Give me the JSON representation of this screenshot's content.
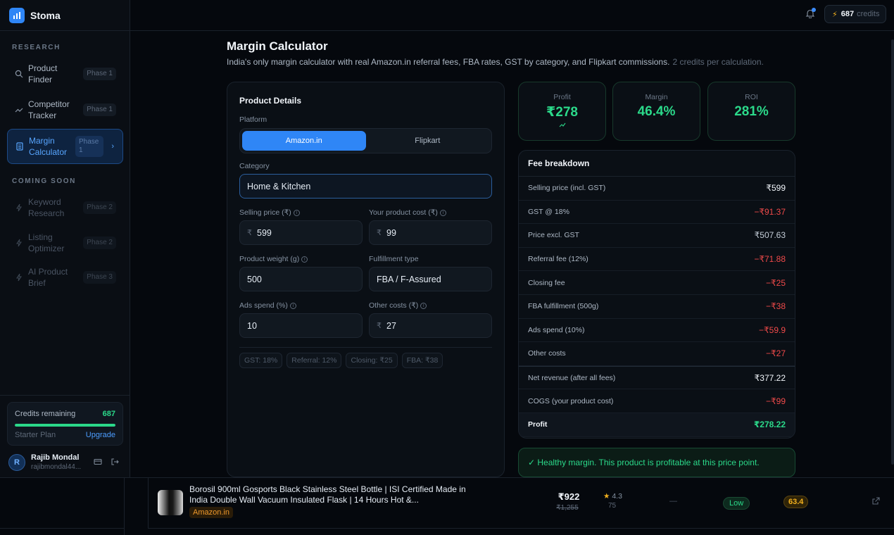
{
  "brand": {
    "name": "Stoma"
  },
  "sidebar": {
    "section_research": "RESEARCH",
    "section_soon": "COMING SOON",
    "research_items": [
      {
        "label": "Product Finder",
        "phase": "Phase 1",
        "icon": "search-icon"
      },
      {
        "label": "Competitor Tracker",
        "phase": "Phase 1",
        "icon": "trend-icon"
      },
      {
        "label": "Margin Calculator",
        "phase": "Phase 1",
        "icon": "calculator-icon"
      }
    ],
    "soon_items": [
      {
        "label": "Keyword Research",
        "phase": "Phase 2",
        "icon": "spark-icon"
      },
      {
        "label": "Listing Optimizer",
        "phase": "Phase 2",
        "icon": "spark-icon"
      },
      {
        "label": "AI Product Brief",
        "phase": "Phase 3",
        "icon": "spark-icon"
      }
    ],
    "credits": {
      "label": "Credits remaining",
      "value": "687",
      "plan": "Starter Plan",
      "upgrade": "Upgrade",
      "fill_fraction": 1.0
    },
    "user": {
      "initial": "R",
      "name": "Rajib Mondal",
      "email": "rajibmondal44..."
    }
  },
  "topbar": {
    "credits_value": "687",
    "credits_label": "credits"
  },
  "page": {
    "title": "Margin Calculator",
    "subtitle": "India's only margin calculator with real Amazon.in referral fees, FBA rates, GST by category, and Flipkart commissions.",
    "subtitle_note": "2 credits per calculation."
  },
  "details": {
    "heading": "Product Details",
    "platform_label": "Platform",
    "platforms": [
      "Amazon.in",
      "Flipkart"
    ],
    "category_label": "Category",
    "category_value": "Home & Kitchen",
    "selling_price_label": "Selling price (₹)",
    "selling_price_value": "599",
    "product_cost_label": "Your product cost (₹)",
    "product_cost_value": "99",
    "weight_label": "Product weight (g)",
    "weight_value": "500",
    "fulfillment_label": "Fulfillment type",
    "fulfillment_value": "FBA / F-Assured",
    "ads_label": "Ads spend (%)",
    "ads_value": "10",
    "other_label": "Other costs (₹)",
    "other_value": "27",
    "currency_symbol": "₹",
    "chips": [
      "GST: 18%",
      "Referral: 12%",
      "Closing: ₹25",
      "FBA: ₹38"
    ]
  },
  "stats": {
    "profit_label": "Profit",
    "profit_value": "₹278",
    "margin_label": "Margin",
    "margin_value": "46.4%",
    "roi_label": "ROI",
    "roi_value": "281%"
  },
  "breakdown": {
    "heading": "Fee breakdown",
    "rows": [
      {
        "label": "Selling price (incl. GST)",
        "value": "₹599"
      },
      {
        "label": "GST @ 18%",
        "value": "−₹91.37"
      },
      {
        "label": "Price excl. GST",
        "value": "₹507.63"
      },
      {
        "label": "Referral fee (12%)",
        "value": "−₹71.88"
      },
      {
        "label": "Closing fee",
        "value": "−₹25"
      },
      {
        "label": "FBA fulfillment (500g)",
        "value": "−₹38"
      },
      {
        "label": "Ads spend (10%)",
        "value": "−₹59.9"
      },
      {
        "label": "Other costs",
        "value": "−₹27"
      },
      {
        "label": "Net revenue (after all fees)",
        "value": "₹377.22"
      },
      {
        "label": "COGS (your product cost)",
        "value": "−₹99"
      },
      {
        "label": "Profit",
        "value": "₹278.22"
      }
    ]
  },
  "healthy_message": "✓ Healthy margin. This product is profitable at this price point.",
  "product_row": {
    "title": "Borosil 900ml Gosports Black Stainless Steel Bottle | ISI Certified Made in India Double Wall Vacuum Insulated Flask | 14 Hours Hot &...",
    "store": "Amazon.in",
    "price": "₹922",
    "old_price": "₹1,255",
    "rating": "4.3",
    "reviews": "75",
    "dash": "—",
    "competition": "Low",
    "score": "63.4"
  },
  "colors": {
    "accent": "#2f86f6",
    "positive": "#2bd98a",
    "negative": "#f04a4a",
    "warning": "#f2b01e"
  }
}
